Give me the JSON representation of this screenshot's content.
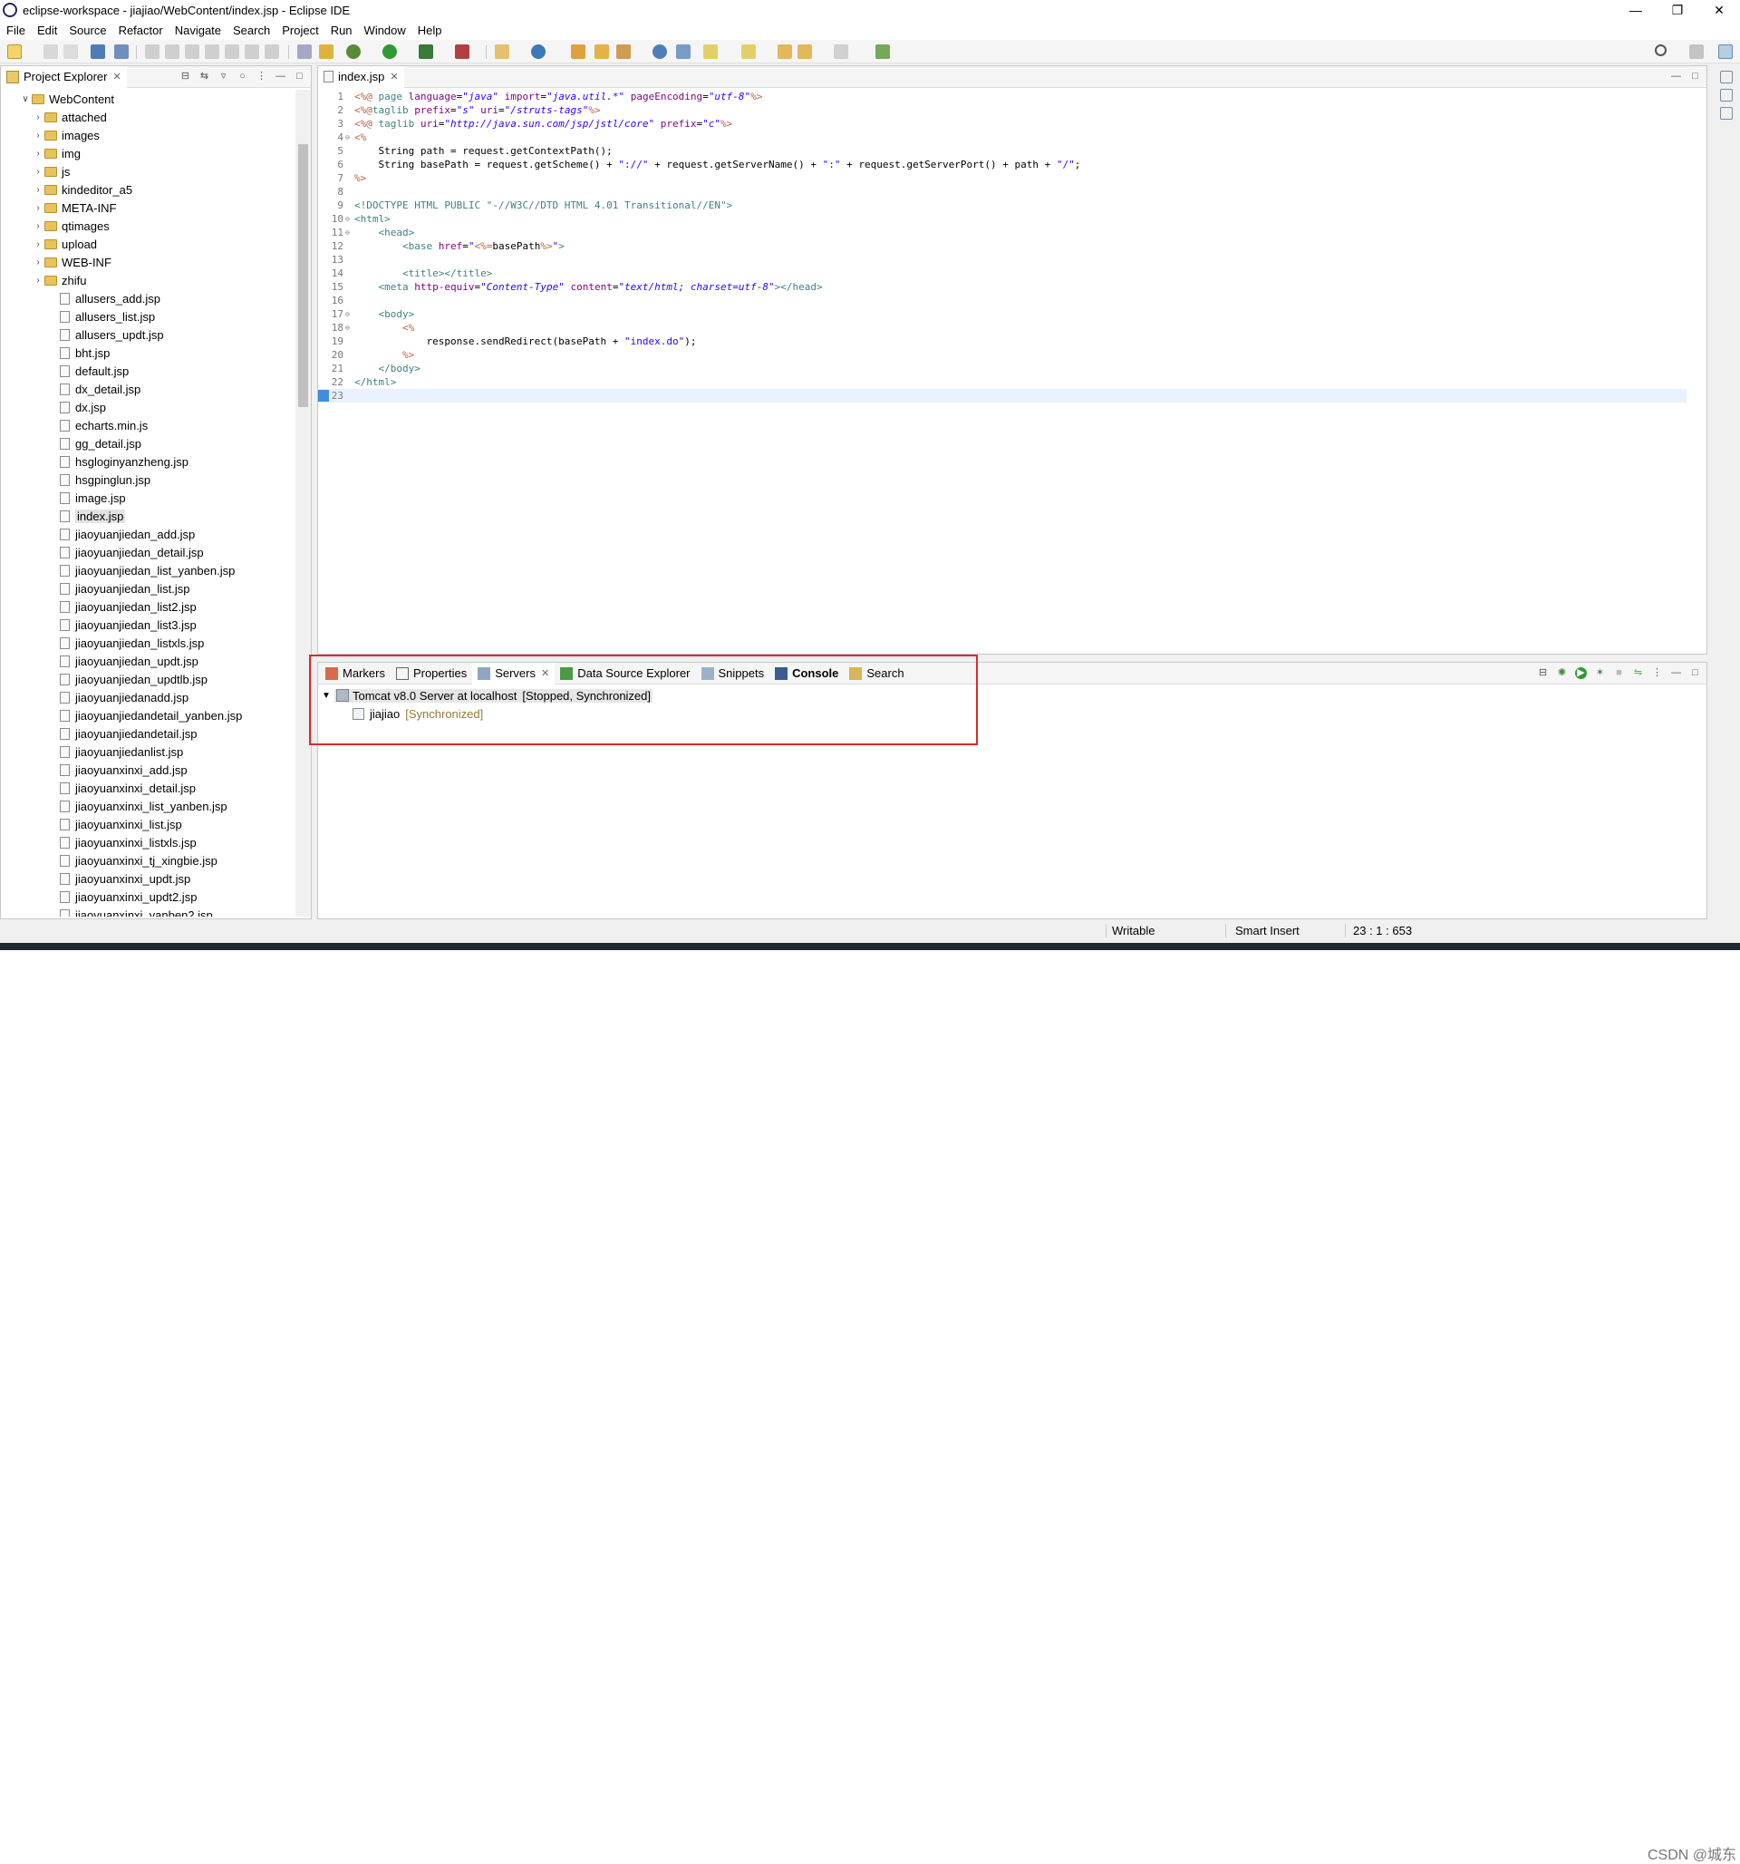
{
  "window": {
    "title": "eclipse-workspace - jiajiao/WebContent/index.jsp - Eclipse IDE",
    "controls": [
      "minimize-icon",
      "restore-icon",
      "close-icon"
    ]
  },
  "menu": [
    "File",
    "Edit",
    "Source",
    "Refactor",
    "Navigate",
    "Search",
    "Project",
    "Run",
    "Window",
    "Help"
  ],
  "project_explorer": {
    "title": "Project Explorer",
    "root": "WebContent",
    "folders": [
      "attached",
      "images",
      "img",
      "js",
      "kindeditor_a5",
      "META-INF",
      "qtimages",
      "upload",
      "WEB-INF",
      "zhifu"
    ],
    "files": [
      "allusers_add.jsp",
      "allusers_list.jsp",
      "allusers_updt.jsp",
      "bht.jsp",
      "default.jsp",
      "dx_detail.jsp",
      "dx.jsp",
      "echarts.min.js",
      "gg_detail.jsp",
      "hsgloginyanzheng.jsp",
      "hsgpinglun.jsp",
      "image.jsp",
      "index.jsp",
      "jiaoyuanjiedan_add.jsp",
      "jiaoyuanjiedan_detail.jsp",
      "jiaoyuanjiedan_list_yanben.jsp",
      "jiaoyuanjiedan_list.jsp",
      "jiaoyuanjiedan_list2.jsp",
      "jiaoyuanjiedan_list3.jsp",
      "jiaoyuanjiedan_listxls.jsp",
      "jiaoyuanjiedan_updt.jsp",
      "jiaoyuanjiedan_updtlb.jsp",
      "jiaoyuanjiedanadd.jsp",
      "jiaoyuanjiedandetail_yanben.jsp",
      "jiaoyuanjiedandetail.jsp",
      "jiaoyuanjiedanlist.jsp",
      "jiaoyuanxinxi_add.jsp",
      "jiaoyuanxinxi_detail.jsp",
      "jiaoyuanxinxi_list_yanben.jsp",
      "jiaoyuanxinxi_list.jsp",
      "jiaoyuanxinxi_listxls.jsp",
      "jiaoyuanxinxi_tj_xingbie.jsp",
      "jiaoyuanxinxi_updt.jsp",
      "jiaoyuanxinxi_updt2.jsp",
      "jiaoyuanxinxi_yanben2.jsp"
    ],
    "selected_file": "index.jsp"
  },
  "editor": {
    "tab_label": "index.jsp",
    "current_line": 23
  },
  "bottom_tabs": [
    {
      "label": "Markers",
      "icon": "markers-icon",
      "active": false
    },
    {
      "label": "Properties",
      "icon": "properties-icon",
      "active": false
    },
    {
      "label": "Servers",
      "icon": "servers-icon",
      "active": true
    },
    {
      "label": "Data Source Explorer",
      "icon": "database-icon",
      "active": false
    },
    {
      "label": "Snippets",
      "icon": "snippets-icon",
      "active": false
    },
    {
      "label": "Console",
      "icon": "console-icon",
      "active": false
    },
    {
      "label": "Search",
      "icon": "search-icon",
      "active": false
    }
  ],
  "servers": {
    "server_name": "Tomcat v8.0 Server at localhost",
    "server_state": "[Stopped, Synchronized]",
    "module_name": "jiajiao",
    "module_state": "[Synchronized]"
  },
  "status": {
    "mode": "Writable",
    "insert": "Smart Insert",
    "position": "23 : 1 : 653"
  },
  "watermark": "CSDN @城东",
  "colors": {
    "highlight_box": "#e0282e",
    "current_line": "#e8f2fe",
    "jsp_delimiter": "#bf5f3f",
    "tag": "#3f7f7f",
    "attribute": "#7f007f",
    "string": "#2a00ff"
  }
}
